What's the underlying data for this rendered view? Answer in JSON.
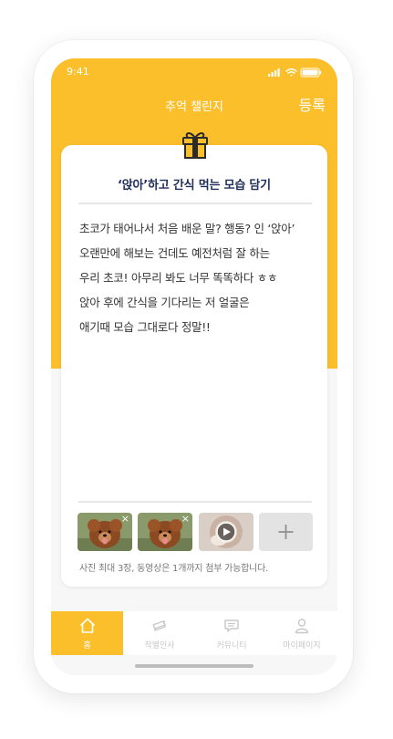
{
  "status_bar": {
    "time": "9:41"
  },
  "header": {
    "title": "추억 챌린지",
    "register_label": "등록"
  },
  "challenge": {
    "title": "‘앉아’하고 간식 먹는 모습 담기",
    "body_lines": [
      "초코가 태어나서 처음 배운 말? 행동? 인 ‘앉아’",
      "오랜만에 해보는 건데도 예전처럼 잘 하는",
      "우리 초코! 아무리 봐도 너무 똑똑하다 ㅎㅎ",
      "앉아 후에 간식을 기다리는 저 얼굴은",
      "애기때 모습 그대로다 정말!!"
    ]
  },
  "attachments": {
    "items": [
      {
        "type": "photo",
        "close_label": "×"
      },
      {
        "type": "photo",
        "close_label": "×"
      },
      {
        "type": "video"
      }
    ],
    "add_icon": "plus-icon",
    "hint": "사진 최대 3장, 동영상은 1개까지 첨부 가능합니다."
  },
  "tabbar": {
    "items": [
      {
        "label": "홈",
        "icon": "home-icon",
        "active": true
      },
      {
        "label": "작별인사",
        "icon": "ticket-icon",
        "active": false
      },
      {
        "label": "커뮤니티",
        "icon": "chat-icon",
        "active": false
      },
      {
        "label": "마이페이지",
        "icon": "user-icon",
        "active": false
      }
    ]
  },
  "colors": {
    "accent": "#fbbf2c",
    "title_text": "#1f2d5a",
    "body_text": "#333333",
    "inactive_tab": "#c8c8c8"
  }
}
